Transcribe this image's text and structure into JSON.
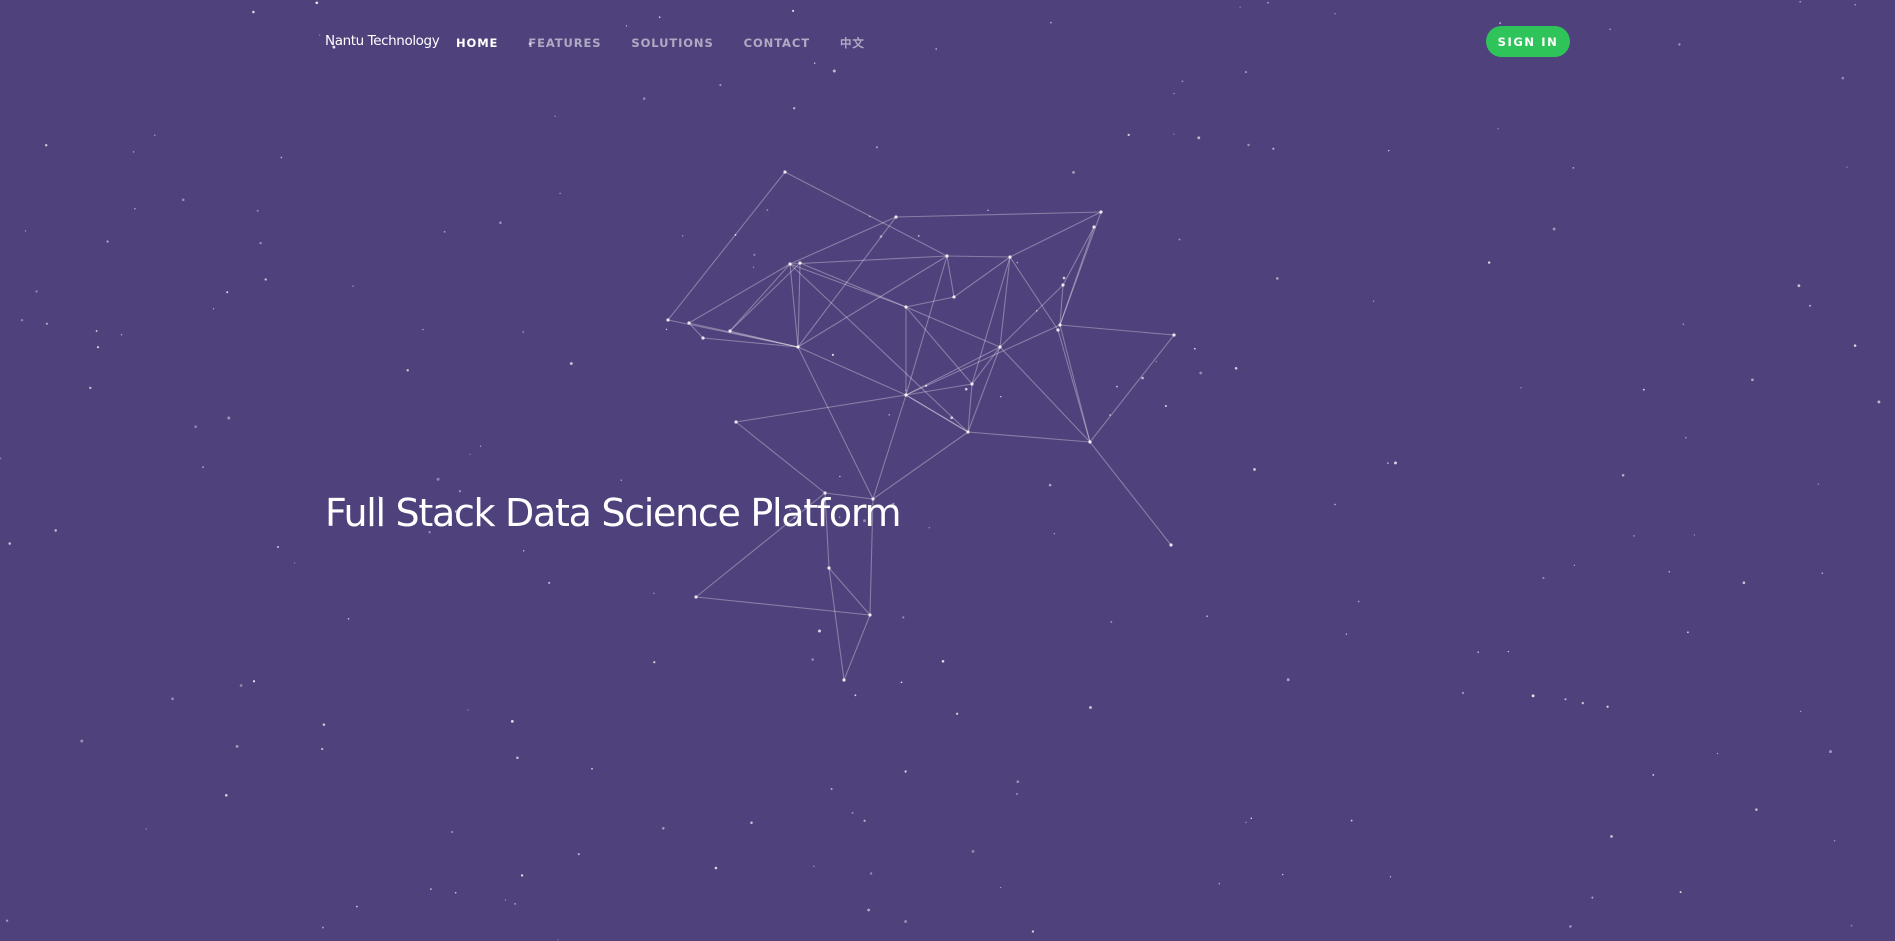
{
  "brand": "Nantu Technology",
  "nav": {
    "items": [
      {
        "label": "HOME",
        "active": true
      },
      {
        "label": "FEATURES",
        "active": false
      },
      {
        "label": "SOLUTIONS",
        "active": false
      },
      {
        "label": "CONTACT",
        "active": false
      },
      {
        "label": "中文",
        "active": false
      }
    ],
    "signin_label": "SIGN IN"
  },
  "hero": {
    "title": "Full Stack Data Science Platform"
  },
  "colors": {
    "background": "#4f417c",
    "accent": "#2fc45a",
    "text": "#ffffff"
  },
  "icons": [
    "network-graph-graphic",
    "starfield-background"
  ]
}
